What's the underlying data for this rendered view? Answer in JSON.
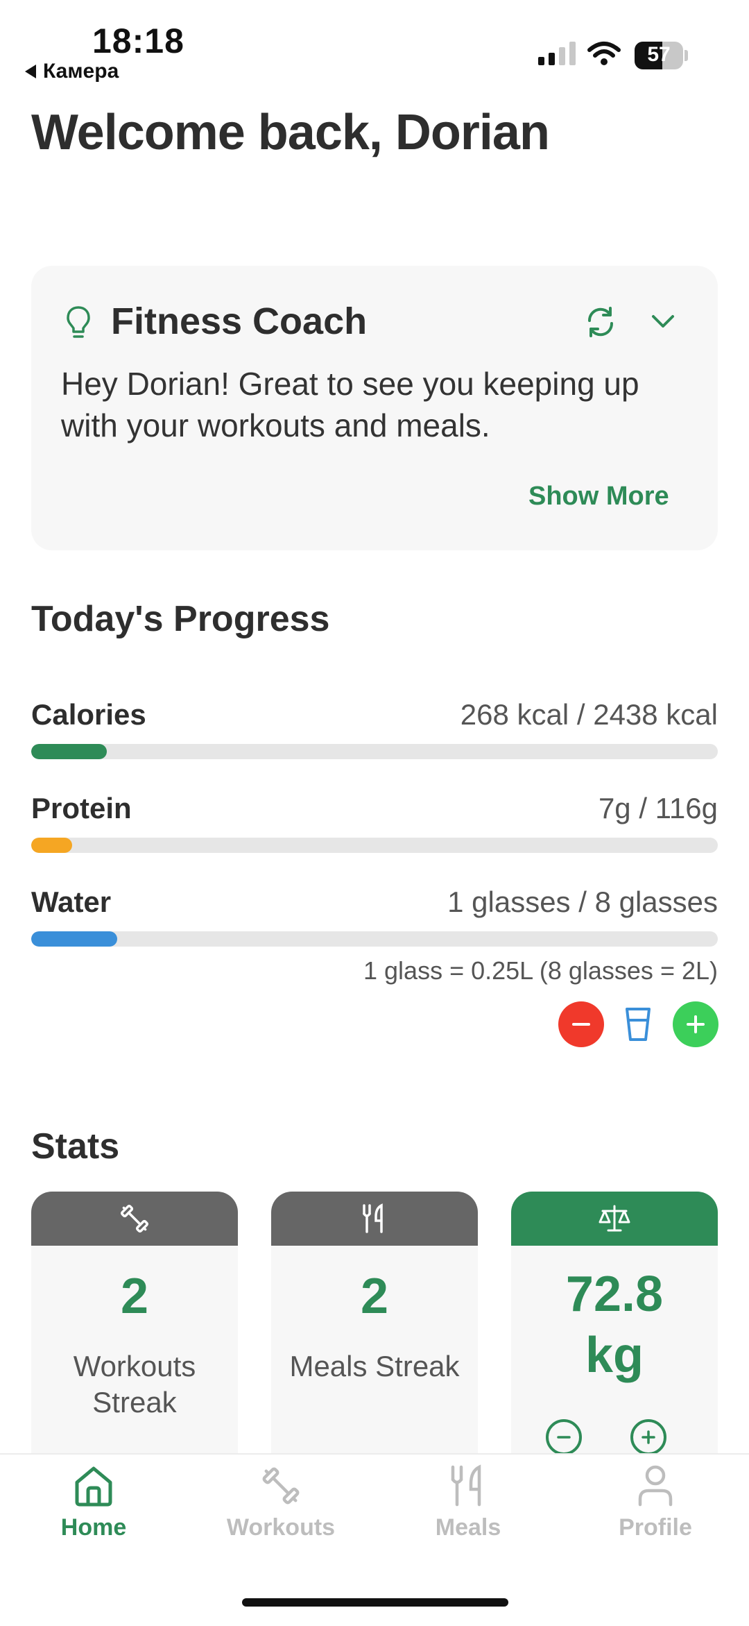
{
  "status_bar": {
    "time": "18:18",
    "back_app": "Камера",
    "battery": "57"
  },
  "header": {
    "welcome": "Welcome back, Dorian"
  },
  "coach": {
    "title": "Fitness Coach",
    "message": "Hey Dorian! Great to see you keeping up with your workouts and meals.",
    "show_more": "Show More",
    "icons": [
      "lightbulb-icon",
      "refresh-icon",
      "chevron-down-icon"
    ]
  },
  "progress": {
    "title": "Today's Progress",
    "items": [
      {
        "label": "Calories",
        "value": "268 kcal / 2438 kcal",
        "fraction": 0.11,
        "color": "#2e8b57"
      },
      {
        "label": "Protein",
        "value": "7g / 116g",
        "fraction": 0.06,
        "color": "#f5a623"
      },
      {
        "label": "Water",
        "value": "1 glasses / 8 glasses",
        "fraction": 0.125,
        "color": "#3a8fd9"
      }
    ],
    "water_note": "1 glass = 0.25L (8 glasses = 2L)"
  },
  "stats": {
    "title": "Stats",
    "cards": [
      {
        "value": "2",
        "label": "Workouts Streak",
        "icon": "dumbbell-icon",
        "header_color": "#666666"
      },
      {
        "value": "2",
        "label": "Meals Streak",
        "icon": "utensils-icon",
        "header_color": "#666666"
      },
      {
        "value": "72.8 kg",
        "label": "",
        "icon": "scale-icon",
        "header_color": "#2e8b57"
      }
    ]
  },
  "tabs": [
    {
      "label": "Home",
      "icon": "home-icon",
      "active": true
    },
    {
      "label": "Workouts",
      "icon": "dumbbell-icon",
      "active": false
    },
    {
      "label": "Meals",
      "icon": "utensils-icon",
      "active": false
    },
    {
      "label": "Profile",
      "icon": "person-icon",
      "active": false
    }
  ],
  "colors": {
    "accent": "#2e8b57",
    "inactive": "#bdbdbd",
    "minus": "#f0392b",
    "plus": "#3ccf5a",
    "water": "#3a8fd9"
  }
}
